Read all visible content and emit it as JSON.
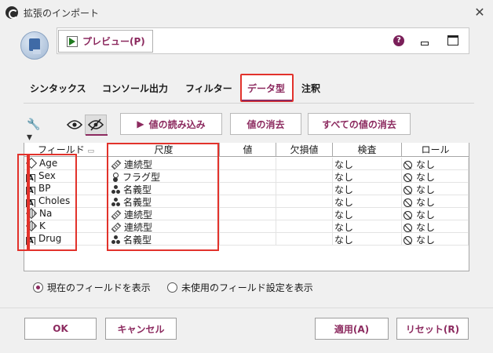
{
  "window": {
    "title": "拡張のインポート"
  },
  "toolbar": {
    "preview_label": "プレビュー(P)"
  },
  "tabs": [
    "シンタックス",
    "コンソール出力",
    "フィルター",
    "データ型",
    "注釈"
  ],
  "active_tab": "データ型",
  "actions": {
    "read_values": "値の読み込み",
    "clear_values": "値の消去",
    "clear_all_values": "すべての値の消去"
  },
  "table": {
    "headers": [
      "フィールド",
      "尺度",
      "値",
      "欠損値",
      "検査",
      "ロール"
    ],
    "rows": [
      {
        "field": "Age",
        "type_icon": "diamond",
        "measure": "連続型",
        "measure_icon": "continuous-icon",
        "value": "",
        "missing": "",
        "check": "なし",
        "role": "なし"
      },
      {
        "field": "Sex",
        "type_icon": "A",
        "measure": "フラグ型",
        "measure_icon": "flag-icon",
        "value": "",
        "missing": "",
        "check": "なし",
        "role": "なし"
      },
      {
        "field": "BP",
        "type_icon": "A",
        "measure": "名義型",
        "measure_icon": "nominal-icon",
        "value": "",
        "missing": "",
        "check": "なし",
        "role": "なし"
      },
      {
        "field": "Choles",
        "type_icon": "A",
        "measure": "名義型",
        "measure_icon": "nominal-icon",
        "value": "",
        "missing": "",
        "check": "なし",
        "role": "なし"
      },
      {
        "field": "Na",
        "type_icon": "diamond-grid",
        "measure": "連続型",
        "measure_icon": "continuous-icon",
        "value": "",
        "missing": "",
        "check": "なし",
        "role": "なし"
      },
      {
        "field": "K",
        "type_icon": "diamond-grid",
        "measure": "連続型",
        "measure_icon": "continuous-icon",
        "value": "",
        "missing": "",
        "check": "なし",
        "role": "なし"
      },
      {
        "field": "Drug",
        "type_icon": "A",
        "measure": "名義型",
        "measure_icon": "nominal-icon",
        "value": "",
        "missing": "",
        "check": "なし",
        "role": "なし"
      }
    ]
  },
  "radios": {
    "current_fields": "現在のフィールドを表示",
    "unused_fields": "未使用のフィールド設定を表示",
    "selected": "current_fields"
  },
  "footer": {
    "ok": "OK",
    "cancel": "キャンセル",
    "apply": "適用(A)",
    "reset": "リセット(R)"
  },
  "colors": {
    "accent": "#8c2a5f",
    "highlight": "#e2322b"
  }
}
